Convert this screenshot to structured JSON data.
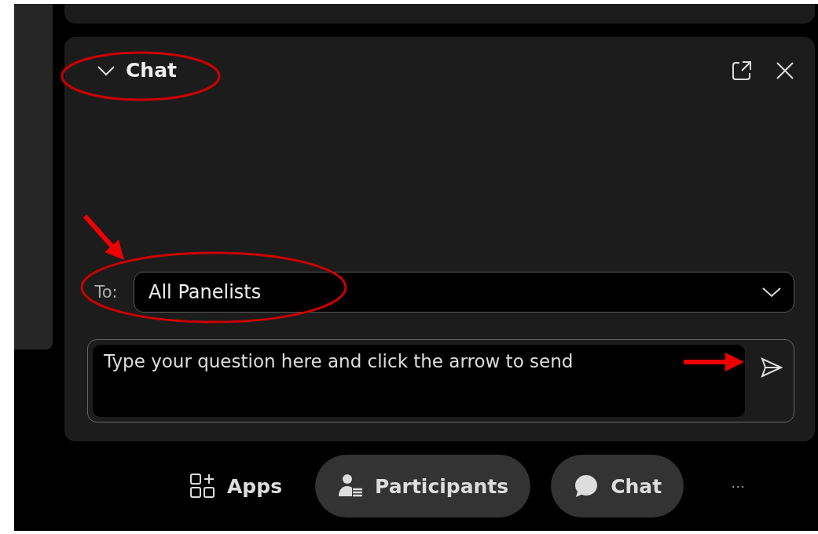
{
  "chat_panel": {
    "title": "Chat",
    "expanded": true
  },
  "recipient": {
    "label": "To:",
    "value": "All Panelists"
  },
  "message": {
    "placeholder": "Type your question here and click the arrow to send"
  },
  "toolbar": [
    {
      "kind": "apps",
      "label": "Apps",
      "selected": false
    },
    {
      "kind": "participants",
      "label": "Participants",
      "selected": true
    },
    {
      "kind": "chat",
      "label": "Chat",
      "selected": true
    },
    {
      "kind": "more",
      "label": "···",
      "selected": false
    }
  ]
}
